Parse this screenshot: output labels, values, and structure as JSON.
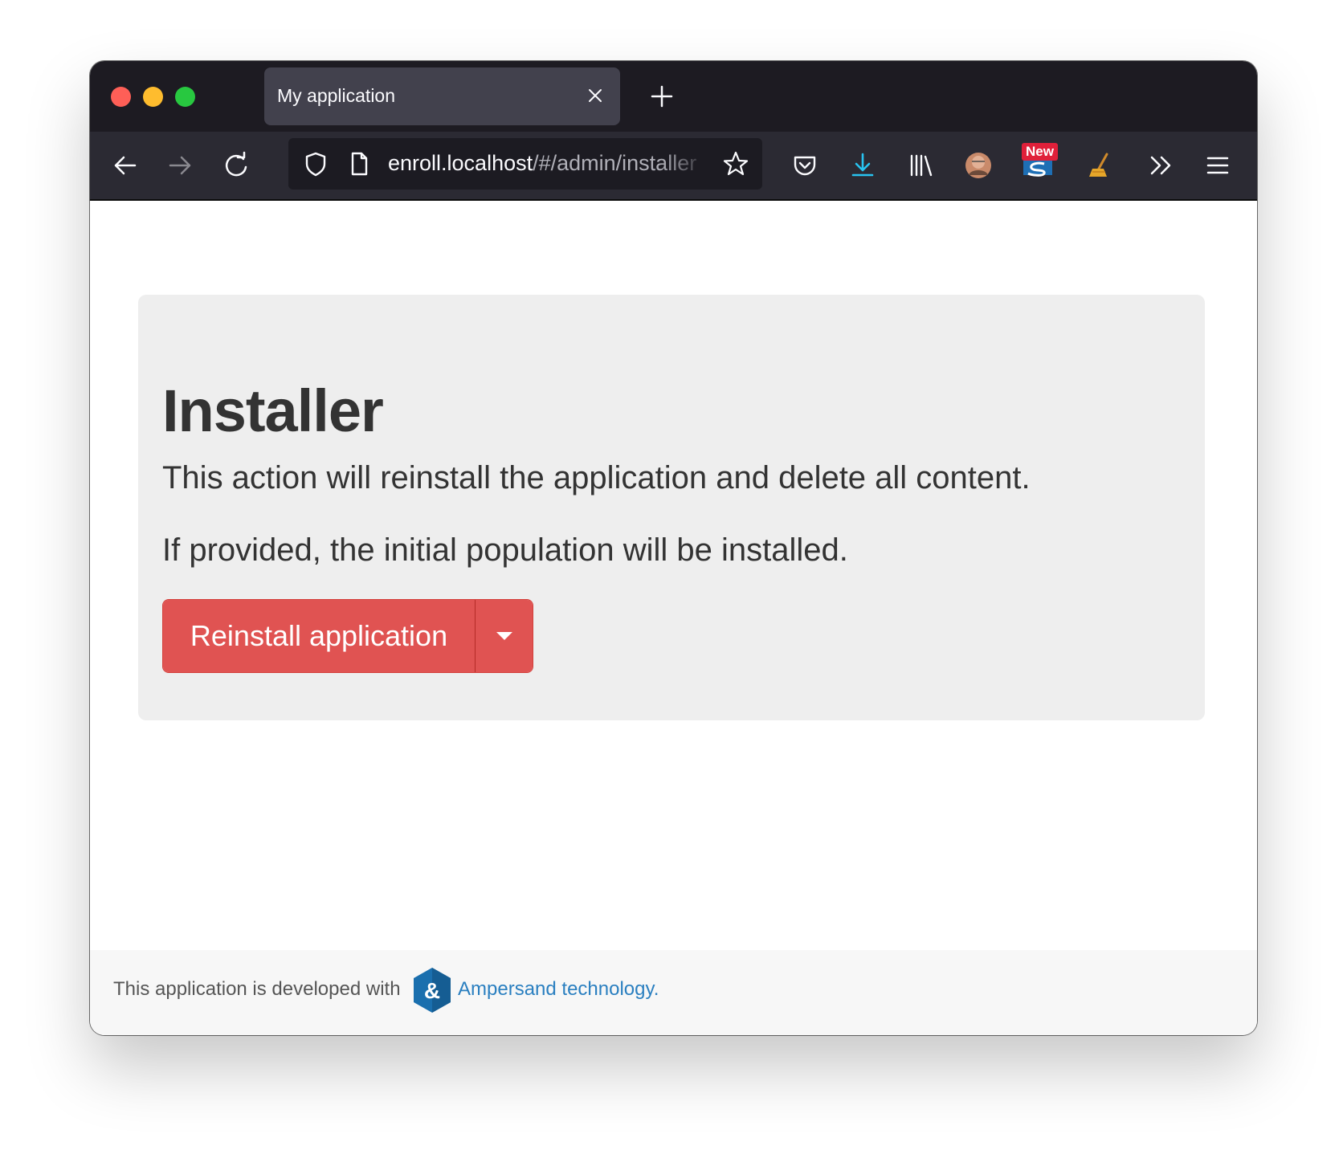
{
  "browser": {
    "tab_title": "My application",
    "url_host": "enroll.localhost",
    "url_path": "/#/admin/installer",
    "badge_new": "New",
    "icons": [
      "back-icon",
      "forward-icon",
      "reload-icon",
      "shield-icon",
      "page-icon",
      "bookmark-star-icon",
      "pocket-icon",
      "download-icon",
      "library-icon",
      "profile-avatar-icon",
      "extension-new-icon",
      "extension-broom-icon",
      "overflow-chevrons-icon",
      "hamburger-menu-icon"
    ]
  },
  "main": {
    "title": "Installer",
    "lead1": "This action will reinstall the application and delete all content.",
    "lead2": "If provided, the initial population will be installed.",
    "reinstall_label": "Reinstall application"
  },
  "footer": {
    "text": "This application is developed with",
    "link_text": "Ampersand technology",
    "period": ".",
    "logo_glyph": "&"
  },
  "colors": {
    "danger": "#e05352",
    "jumbotron": "#eeeeee",
    "link": "#2a7fc0",
    "download_accent": "#28c3f0",
    "logo": "#1a6fae"
  }
}
